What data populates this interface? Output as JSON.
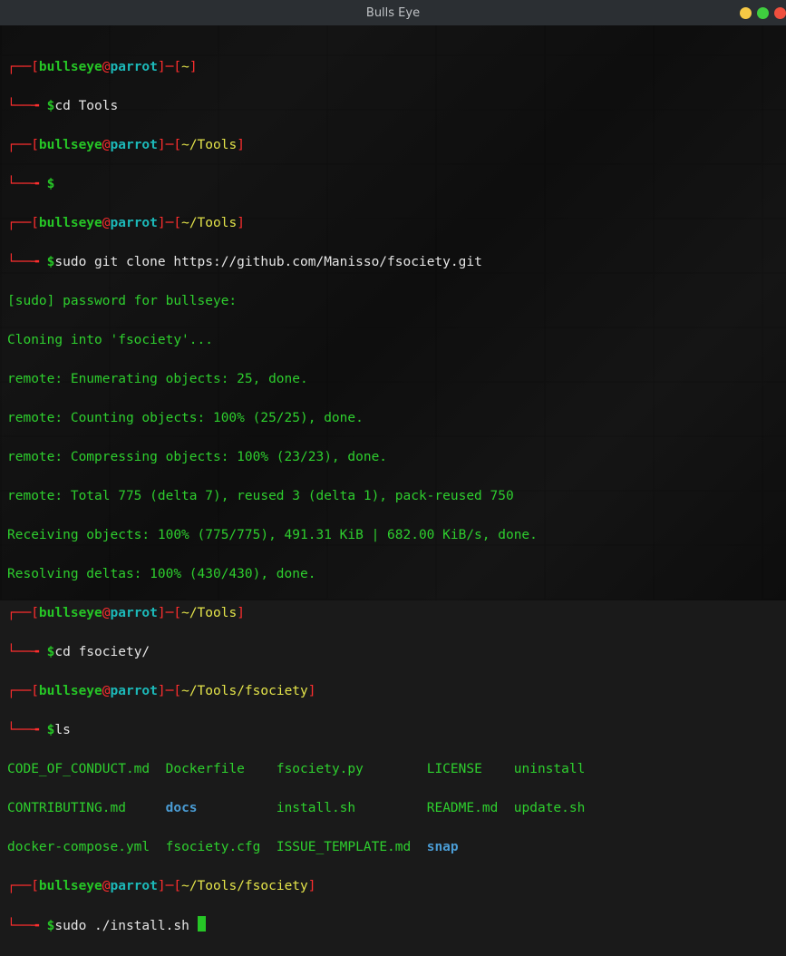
{
  "window": {
    "title": "Bulls Eye"
  },
  "prompt": {
    "lbr": "┌──[",
    "rbr": "]",
    "dash": "─",
    "at": "@",
    "tilde": "~",
    "elbow": "└──╼",
    "dollar": " $",
    "user": "bullseye",
    "host": "parrot",
    "home": "~",
    "path_tools": "~/Tools",
    "path_fsoc": "~/Tools/fsociety"
  },
  "cmd": {
    "cd_tools": "cd Tools",
    "clone": "sudo git clone https://github.com/Manisso/fsociety.git",
    "cd_fsoc": "cd fsociety/",
    "ls": "ls",
    "install": "sudo ./install.sh "
  },
  "out": {
    "sudo_pw": "[sudo] password for bullseye:",
    "clone_l1": "Cloning into 'fsociety'...",
    "clone_l2": "remote: Enumerating objects: 25, done.",
    "clone_l3": "remote: Counting objects: 100% (25/25), done.",
    "clone_l4": "remote: Compressing objects: 100% (23/23), done.",
    "clone_l5": "remote: Total 775 (delta 7), reused 3 (delta 1), pack-reused 750",
    "clone_l6": "Receiving objects: 100% (775/775), 491.31 KiB | 682.00 KiB/s, done.",
    "clone_l7": "Resolving deltas: 100% (430/430), done."
  },
  "ls_cols": {
    "c1r1": "CODE_OF_CONDUCT.md",
    "c1r2": "CONTRIBUTING.md",
    "c1r3": "docker-compose.yml",
    "c2r1": "Dockerfile",
    "c2r2": "docs",
    "c2r3": "fsociety.cfg",
    "c3r1": "fsociety.py",
    "c3r2": "install.sh",
    "c3r3": "ISSUE_TEMPLATE.md",
    "c4r1": "LICENSE",
    "c4r2": "README.md",
    "c4r3": "snap",
    "c5r1": "uninstall",
    "c5r2": "update.sh"
  },
  "pad": {
    "c1r1": "  ",
    "c1r2": "     ",
    "c1r3": "  ",
    "c2r1": "    ",
    "c2r2": "          ",
    "c2r3": "  ",
    "c3r1": "        ",
    "c3r2": "         ",
    "c3r3": "  ",
    "c4r1": "    ",
    "c4r2": "  "
  }
}
